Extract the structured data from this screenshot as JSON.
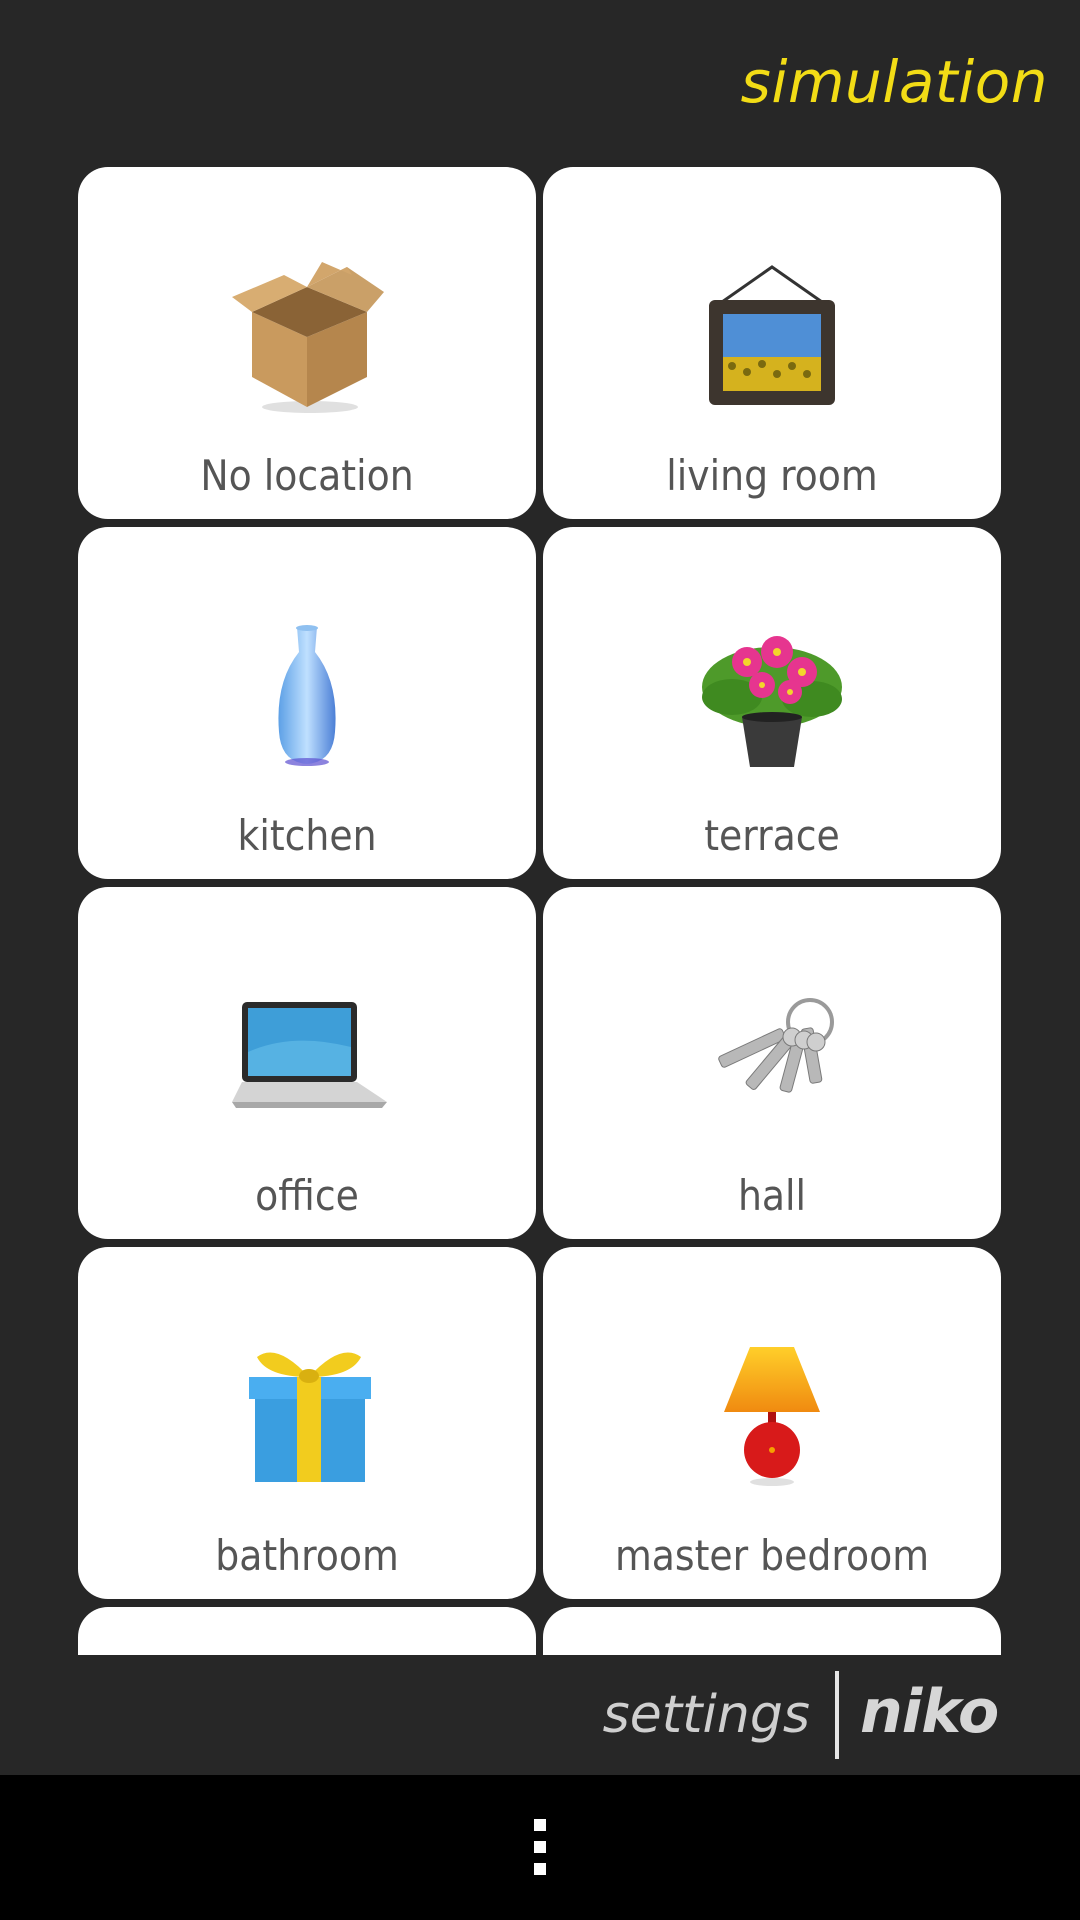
{
  "header": {
    "title": "simulation"
  },
  "tiles": [
    {
      "label": "No location",
      "icon": "cardboard-box-icon"
    },
    {
      "label": "living room",
      "icon": "picture-frame-icon"
    },
    {
      "label": "kitchen",
      "icon": "vase-icon"
    },
    {
      "label": "terrace",
      "icon": "flower-pot-icon"
    },
    {
      "label": "office",
      "icon": "laptop-icon"
    },
    {
      "label": "hall",
      "icon": "keys-icon"
    },
    {
      "label": "bathroom",
      "icon": "gift-box-icon"
    },
    {
      "label": "master bedroom",
      "icon": "lamp-icon"
    }
  ],
  "footer": {
    "settings_label": "settings",
    "brand": "niko"
  },
  "colors": {
    "background": "#272727",
    "accent": "#f2dc16",
    "tile": "#ffffff",
    "label": "#555555"
  }
}
